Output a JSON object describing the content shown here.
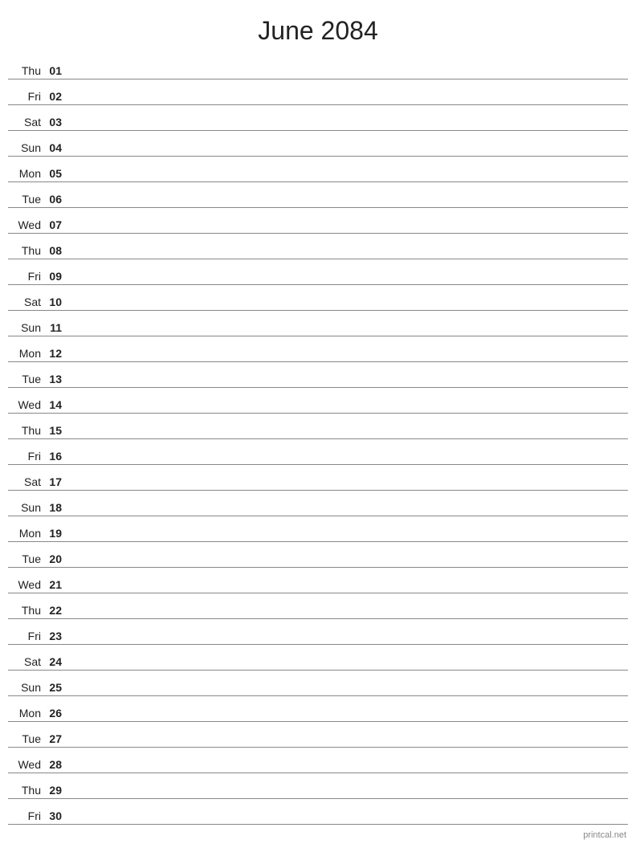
{
  "title": "June 2084",
  "watermark": "printcal.net",
  "days": [
    {
      "name": "Thu",
      "number": "01"
    },
    {
      "name": "Fri",
      "number": "02"
    },
    {
      "name": "Sat",
      "number": "03"
    },
    {
      "name": "Sun",
      "number": "04"
    },
    {
      "name": "Mon",
      "number": "05"
    },
    {
      "name": "Tue",
      "number": "06"
    },
    {
      "name": "Wed",
      "number": "07"
    },
    {
      "name": "Thu",
      "number": "08"
    },
    {
      "name": "Fri",
      "number": "09"
    },
    {
      "name": "Sat",
      "number": "10"
    },
    {
      "name": "Sun",
      "number": "11"
    },
    {
      "name": "Mon",
      "number": "12"
    },
    {
      "name": "Tue",
      "number": "13"
    },
    {
      "name": "Wed",
      "number": "14"
    },
    {
      "name": "Thu",
      "number": "15"
    },
    {
      "name": "Fri",
      "number": "16"
    },
    {
      "name": "Sat",
      "number": "17"
    },
    {
      "name": "Sun",
      "number": "18"
    },
    {
      "name": "Mon",
      "number": "19"
    },
    {
      "name": "Tue",
      "number": "20"
    },
    {
      "name": "Wed",
      "number": "21"
    },
    {
      "name": "Thu",
      "number": "22"
    },
    {
      "name": "Fri",
      "number": "23"
    },
    {
      "name": "Sat",
      "number": "24"
    },
    {
      "name": "Sun",
      "number": "25"
    },
    {
      "name": "Mon",
      "number": "26"
    },
    {
      "name": "Tue",
      "number": "27"
    },
    {
      "name": "Wed",
      "number": "28"
    },
    {
      "name": "Thu",
      "number": "29"
    },
    {
      "name": "Fri",
      "number": "30"
    }
  ]
}
